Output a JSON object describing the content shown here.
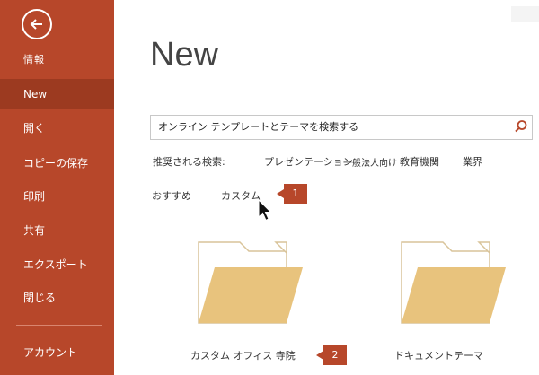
{
  "sidebar": {
    "back_icon": "back-arrow-icon",
    "items": [
      {
        "label": "情報"
      },
      {
        "label": "New"
      },
      {
        "label": "開く"
      },
      {
        "label": "コピーの保存"
      },
      {
        "label": "印刷"
      },
      {
        "label": "共有"
      },
      {
        "label": "エクスポート"
      },
      {
        "label": "閉じる"
      },
      {
        "label": "アカウント"
      }
    ],
    "active": "New",
    "bg_color": "#b7472a",
    "active_color": "#9c3a20"
  },
  "main": {
    "title": "New",
    "search": {
      "value": "オンライン テンプレートとテーマを検索する",
      "icon": "search-icon"
    },
    "suggested": {
      "label": "推奨される検索:",
      "links": [
        "プレゼンテーション",
        "一般法人向け",
        "教育機関",
        "業界"
      ]
    },
    "tabs": [
      "おすすめ",
      "カスタム"
    ],
    "callouts": [
      "1",
      "2"
    ],
    "folders": [
      {
        "label": "カスタム オフィス 寺院",
        "icon": "folder-icon"
      },
      {
        "label": "ドキュメントテーマ",
        "icon": "folder-icon"
      }
    ]
  }
}
